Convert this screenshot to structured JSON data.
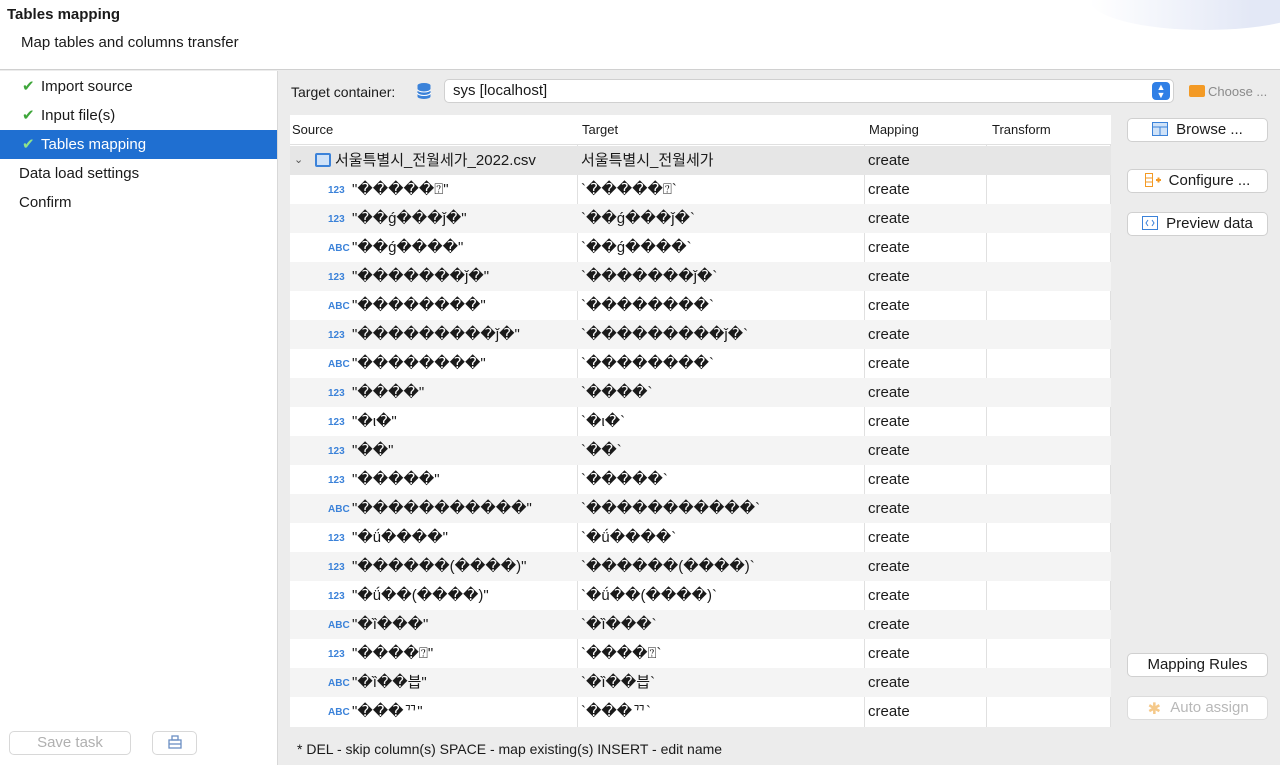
{
  "header": {
    "title": "Tables mapping",
    "subtitle": "Map tables and columns transfer"
  },
  "sidebar": {
    "steps": [
      {
        "label": "Import source",
        "done": true
      },
      {
        "label": "Input file(s)",
        "done": true
      },
      {
        "label": "Tables mapping",
        "done": true,
        "active": true
      },
      {
        "label": "Data load settings",
        "done": false
      },
      {
        "label": "Confirm",
        "done": false
      }
    ],
    "save_task": "Save task"
  },
  "target_container": {
    "label": "Target container:",
    "value": "sys  [localhost]",
    "choose": "Choose ..."
  },
  "table": {
    "columns": [
      "Source",
      "Target",
      "Mapping",
      "Transform"
    ],
    "parent": {
      "source": "서울특별시_전월세가_2022.csv",
      "target": "서울특별시_전월세가",
      "mapping": "create"
    },
    "rows": [
      {
        "type": "123",
        "source": "\"�����⍰\"",
        "target": "`�����⍰`",
        "mapping": "create"
      },
      {
        "type": "123",
        "source": "\"��ǵ���ǰ�\"",
        "target": "`��ǵ���ǰ�`",
        "mapping": "create"
      },
      {
        "type": "ABC",
        "source": "\"��ǵ����\"",
        "target": "`��ǵ����`",
        "mapping": "create"
      },
      {
        "type": "123",
        "source": "\"�������ǰ�\"",
        "target": "`�������ǰ�`",
        "mapping": "create"
      },
      {
        "type": "ABC",
        "source": "\"��������\"",
        "target": "`��������`",
        "mapping": "create"
      },
      {
        "type": "123",
        "source": "\"���������ǰ�\"",
        "target": "`���������ǰ�`",
        "mapping": "create"
      },
      {
        "type": "ABC",
        "source": "\"��������\"",
        "target": "`��������`",
        "mapping": "create"
      },
      {
        "type": "123",
        "source": "\"����\"",
        "target": "`����`",
        "mapping": "create"
      },
      {
        "type": "123",
        "source": "\"�ι�\"",
        "target": "`�ι�`",
        "mapping": "create"
      },
      {
        "type": "123",
        "source": "\"��\"",
        "target": "`��`",
        "mapping": "create"
      },
      {
        "type": "123",
        "source": "\"�����\"",
        "target": "`�����`",
        "mapping": "create"
      },
      {
        "type": "ABC",
        "source": "\"�����������\"",
        "target": "`�����������`",
        "mapping": "create"
      },
      {
        "type": "123",
        "source": "\"�ǘ����\"",
        "target": "`�ǘ����`",
        "mapping": "create"
      },
      {
        "type": "123",
        "source": "\"������(����)\"",
        "target": "`������(����)`",
        "mapping": "create"
      },
      {
        "type": "123",
        "source": "\"�ǘ��(����)\"",
        "target": "`�ǘ��(����)`",
        "mapping": "create"
      },
      {
        "type": "ABC",
        "source": "\"�ȉ���\"",
        "target": "`�ȉ���`",
        "mapping": "create"
      },
      {
        "type": "123",
        "source": "\"����⍰\"",
        "target": "`����⍰`",
        "mapping": "create"
      },
      {
        "type": "ABC",
        "source": "\"�ȉ��븝\"",
        "target": "`�ȉ��븝`",
        "mapping": "create"
      },
      {
        "type": "ABC",
        "source": "\"���ᄁ\"",
        "target": "`���ᄁ`",
        "mapping": "create"
      }
    ]
  },
  "right_panel": {
    "browse": "Browse ...",
    "configure": "Configure ...",
    "preview": "Preview data",
    "mapping_rules": "Mapping Rules",
    "auto_assign": "Auto assign"
  },
  "hint": "* DEL - skip column(s)  SPACE - map existing(s)  INSERT - edit name",
  "colors": {
    "accent": "#1f6fd1",
    "check": "#3ea63a",
    "type_badge": "#3b82d9",
    "folder": "#f39a25"
  }
}
